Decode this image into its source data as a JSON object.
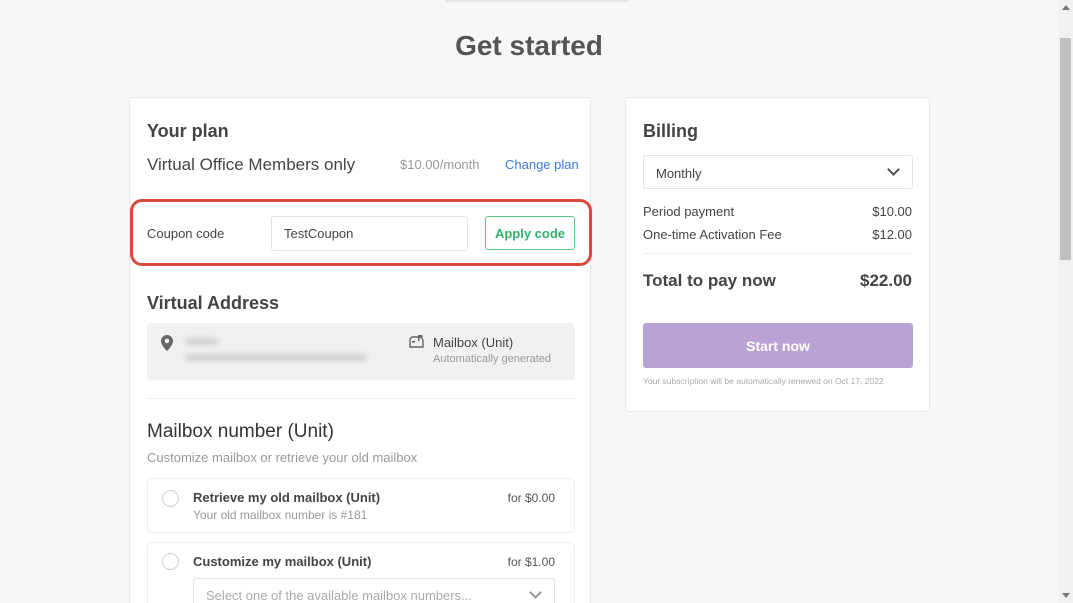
{
  "page": {
    "title": "Get started"
  },
  "plan": {
    "heading": "Your plan",
    "name": "Virtual Office Members only",
    "price": "$10.00/month",
    "change_link": "Change plan",
    "coupon_label": "Coupon code",
    "coupon_value": "TestCoupon",
    "apply_label": "Apply code"
  },
  "address": {
    "heading": "Virtual Address",
    "mailbox_label": "Mailbox (Unit)",
    "mailbox_sub": "Automatically generated"
  },
  "mailbox": {
    "heading": "Mailbox number (Unit)",
    "subheading": "Customize mailbox or retrieve your old mailbox",
    "options": [
      {
        "title": "Retrieve my old mailbox (Unit)",
        "sub": "Your old mailbox number is #181",
        "price": "for $0.00"
      },
      {
        "title": "Customize my mailbox (Unit)",
        "price": "for $1.00",
        "select_placeholder": "Select one of the available mailbox numbers..."
      }
    ]
  },
  "billing": {
    "heading": "Billing",
    "period_selected": "Monthly",
    "rows": [
      {
        "label": "Period payment",
        "value": "$10.00"
      },
      {
        "label": "One-time Activation Fee",
        "value": "$12.00"
      }
    ],
    "total_label": "Total to pay now",
    "total_value": "$22.00",
    "start_label": "Start now",
    "renew_note": "Your subscription will be automatically renewed on Oct 17, 2022"
  },
  "colors": {
    "accent_link": "#3d7bd1",
    "apply_green": "#2fb46c",
    "highlight_red": "#d94a3d",
    "start_button": "#b9a3d5"
  },
  "icons": [
    "location-pin-icon",
    "mailbox-icon",
    "chevron-down-icon"
  ]
}
